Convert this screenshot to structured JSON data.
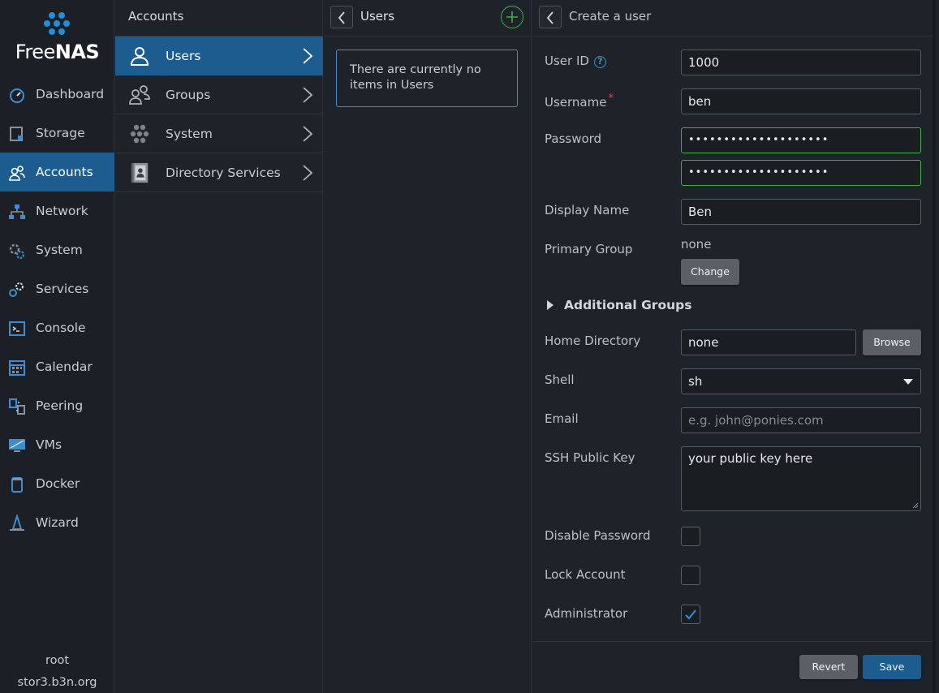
{
  "brand": {
    "name_light": "Free",
    "name_bold": "NAS"
  },
  "nav": {
    "items": [
      {
        "label": "Dashboard",
        "icon": "gauge-icon"
      },
      {
        "label": "Storage",
        "icon": "storage-icon"
      },
      {
        "label": "Accounts",
        "icon": "accounts-icon",
        "active": true
      },
      {
        "label": "Network",
        "icon": "network-icon"
      },
      {
        "label": "System",
        "icon": "system-icon"
      },
      {
        "label": "Services",
        "icon": "services-icon"
      },
      {
        "label": "Console",
        "icon": "console-icon"
      },
      {
        "label": "Calendar",
        "icon": "calendar-icon"
      },
      {
        "label": "Peering",
        "icon": "peering-icon"
      },
      {
        "label": "VMs",
        "icon": "vm-icon"
      },
      {
        "label": "Docker",
        "icon": "docker-icon"
      },
      {
        "label": "Wizard",
        "icon": "wizard-icon"
      }
    ],
    "user": "root",
    "host": "stor3.b3n.org"
  },
  "accounts": {
    "title": "Accounts",
    "items": [
      {
        "label": "Users",
        "icon": "user-icon",
        "active": true
      },
      {
        "label": "Groups",
        "icon": "group-icon"
      },
      {
        "label": "System",
        "icon": "system-dots-icon"
      },
      {
        "label": "Directory Services",
        "icon": "directory-book-icon"
      }
    ]
  },
  "users": {
    "title": "Users",
    "empty_message": "There are currently no items in Users"
  },
  "create_user": {
    "title": "Create a user",
    "user_id_label": "User ID",
    "user_id_value": "1000",
    "username_label": "Username",
    "username_required": "*",
    "username_value": "ben",
    "password_label": "Password",
    "password_value": "••••••••••••••••••••",
    "password_confirm_value": "••••••••••••••••••••",
    "display_name_label": "Display Name",
    "display_name_value": "Ben",
    "primary_group_label": "Primary Group",
    "primary_group_value": "none",
    "change_label": "Change",
    "additional_groups_label": "Additional Groups",
    "home_directory_label": "Home Directory",
    "home_directory_value": "none",
    "browse_label": "Browse",
    "shell_label": "Shell",
    "shell_value": "sh",
    "email_label": "Email",
    "email_placeholder": "e.g. john@ponies.com",
    "ssh_key_label": "SSH Public Key",
    "ssh_key_value": "your public key here",
    "disable_password_label": "Disable Password",
    "disable_password_checked": false,
    "lock_account_label": "Lock Account",
    "lock_account_checked": false,
    "administrator_label": "Administrator",
    "administrator_checked": true,
    "revert_label": "Revert",
    "save_label": "Save"
  },
  "colors": {
    "accent": "#1d5c8f",
    "valid": "#3fae4d",
    "info": "#3a8fd0",
    "required": "#d94b4b"
  }
}
